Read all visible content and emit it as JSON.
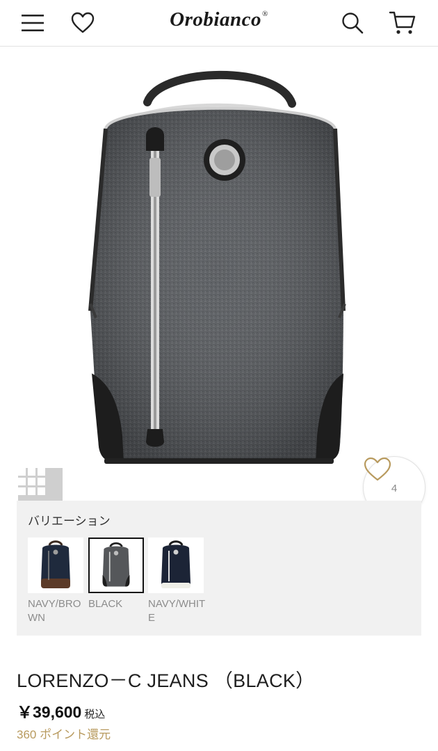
{
  "header": {
    "logo": "Orobianco",
    "logo_mark": "®",
    "menu_icon": "hamburger-menu-icon",
    "favorite_icon": "heart-outline-icon",
    "search_icon": "search-icon",
    "cart_icon": "cart-icon"
  },
  "hero": {
    "image": "backpack-product-photo",
    "grid_icon": "grid-view-icon",
    "like_count": "4"
  },
  "variations": {
    "title": "バリエーション",
    "items": [
      {
        "label": "NAVY/BROWN",
        "selected": false,
        "color": "#1f2a3d"
      },
      {
        "label": "BLACK",
        "selected": true,
        "color": "#55575a"
      },
      {
        "label": "NAVY/WHITE",
        "selected": false,
        "color": "#1c2436"
      }
    ]
  },
  "product": {
    "name": "LORENZO－C JEANS （BLACK）",
    "price": "￥39,600",
    "tax_label": "税込",
    "points": "360 ポイント還元"
  },
  "colors": {
    "points_gold": "#b89a5e",
    "variation_bg": "#f1f1f1"
  }
}
